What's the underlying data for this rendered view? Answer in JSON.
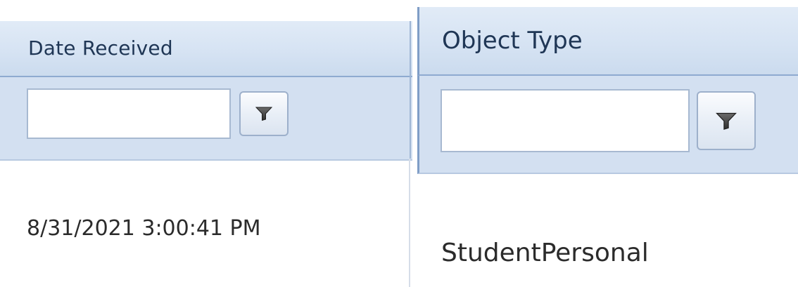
{
  "columns": [
    {
      "header": "Date Received",
      "filter_value": "",
      "cell_value": "8/31/2021 3:00:41 PM"
    },
    {
      "header": "Object Type",
      "filter_value": "",
      "cell_value": "StudentPersonal"
    }
  ],
  "icons": {
    "filter": "filter-funnel-icon"
  },
  "colors": {
    "header_background": "#d6e3f3",
    "filter_row_background": "#d3e0f1",
    "header_border": "#8eaad0",
    "header_text": "#1f3655"
  }
}
